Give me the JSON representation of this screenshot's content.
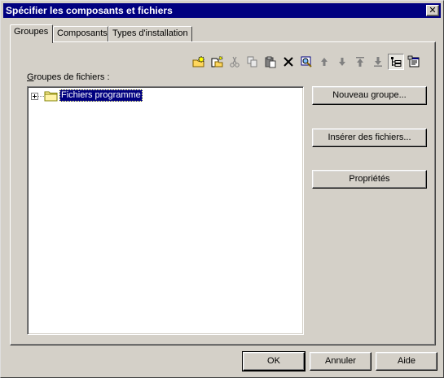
{
  "window": {
    "title": "Spécifier les composants et fichiers",
    "close_glyph": "✕"
  },
  "tabs": [
    {
      "label": "Groupes",
      "active": true
    },
    {
      "label": "Composants",
      "active": false
    },
    {
      "label": "Types d'installation",
      "active": false
    }
  ],
  "toolbar": {
    "icons": [
      "new-folder-icon",
      "new-item-icon",
      "cut-icon",
      "copy-icon",
      "paste-icon",
      "delete-icon",
      "find-icon",
      "move-up-icon",
      "move-down-icon",
      "move-top-icon",
      "move-bottom-icon",
      "tree-view-icon",
      "properties-icon"
    ],
    "pressed": "tree-view-icon"
  },
  "groups": {
    "label": "Groupes de fichiers :",
    "tree": [
      {
        "label": "Fichiers programme",
        "expandable": true,
        "selected": true
      }
    ]
  },
  "side_buttons": {
    "new_group": "Nouveau groupe...",
    "insert_files": "Insérer des fichiers...",
    "properties": "Propriétés"
  },
  "footer": {
    "ok": "OK",
    "cancel": "Annuler",
    "help": "Aide"
  },
  "colors": {
    "title_bar": "#000080",
    "face": "#d4d0c8",
    "selection": "#000080"
  }
}
